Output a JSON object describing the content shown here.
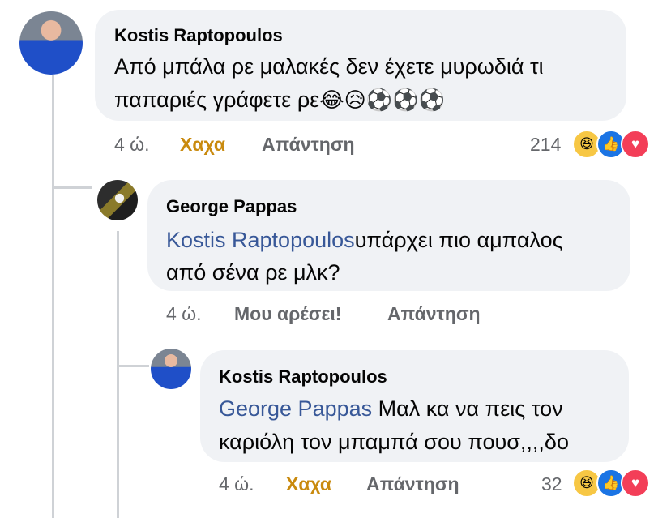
{
  "comments": [
    {
      "author": "Kostis Raptopoulos",
      "line1": "Από μπάλα ρε μαλακές δεν έχετε μυρωδιά τι",
      "line2": "παπαριές γράφετε ρε",
      "emojis": "😂😥⚽⚽⚽",
      "time": "4 ώ.",
      "reaction_label": "Χαχα",
      "reply_label": "Απάντηση",
      "reaction_count": "214"
    },
    {
      "author": "George Pappas",
      "mention": "Kostis Raptopoulos",
      "line1_rest": "υπάρχει πιο αμπαλος",
      "line2": "από σένα ρε μλκ?",
      "time": "4 ώ.",
      "reaction_label": "Μου αρέσει!",
      "reply_label": "Απάντηση"
    },
    {
      "author": "Kostis Raptopoulos",
      "mention": "George Pappas",
      "line1_rest": " Μαλ κα να πεις τον",
      "line2": "καριόλη τον μπαμπά σου πουσ,,,,δο",
      "time": "4 ώ.",
      "reaction_label": "Χαχα",
      "reply_label": "Απάντηση",
      "reaction_count": "32"
    }
  ],
  "reaction_icons": [
    "haha-icon",
    "like-icon",
    "love-icon"
  ],
  "colors": {
    "bubble": "#f0f2f5",
    "mention": "#385898",
    "haha": "#c98a0e",
    "meta": "#65676b"
  }
}
